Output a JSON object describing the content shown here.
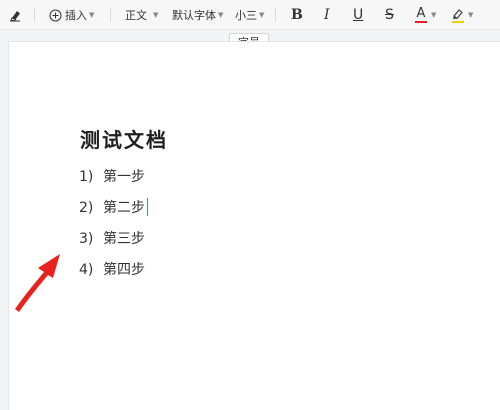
{
  "toolbar": {
    "eraser_icon": "eraser-icon",
    "insert_label": "插入",
    "style_label": "正文",
    "font_label": "默认字体",
    "size_label": "小三",
    "bold_label": "B",
    "italic_label": "I",
    "underline_label": "U",
    "strike_label": "S",
    "font_color_label": "A",
    "font_color": "#e02020",
    "highlight_color": "#f5d000"
  },
  "tooltip": {
    "text": "字号"
  },
  "document": {
    "title": "测试文档",
    "items": [
      {
        "num": "1)",
        "text": "第一步"
      },
      {
        "num": "2)",
        "text": "第二步"
      },
      {
        "num": "3)",
        "text": "第三步"
      },
      {
        "num": "4)",
        "text": "第四步"
      }
    ]
  },
  "annotation": {
    "arrow_color": "#e8231f"
  }
}
